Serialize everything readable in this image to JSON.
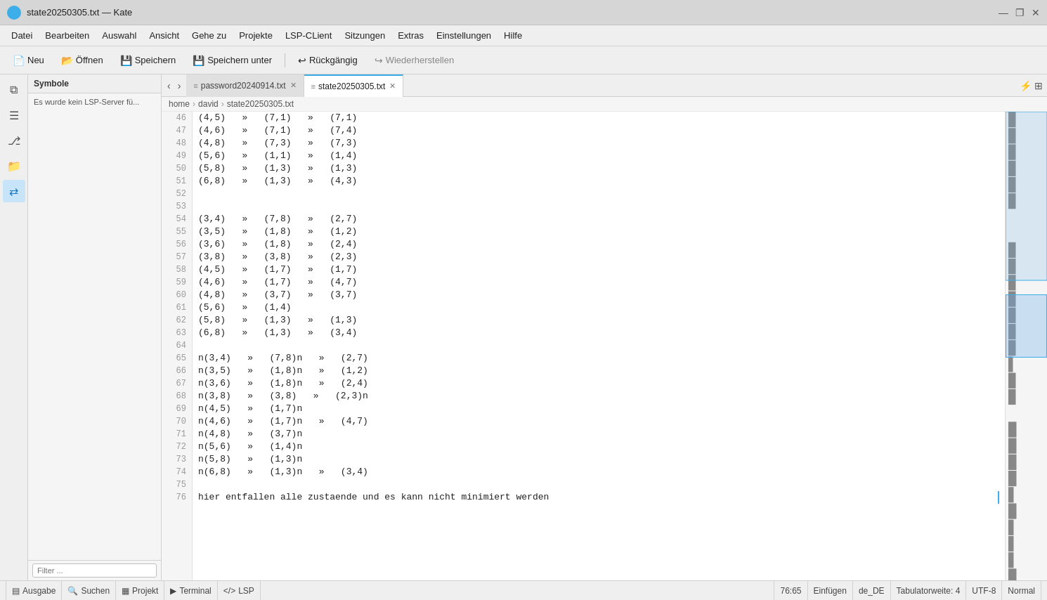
{
  "titleBar": {
    "title": "state20250305.txt — Kate",
    "icon": "kate-icon",
    "buttons": {
      "minimize": "—",
      "restore": "❐",
      "close": "✕"
    }
  },
  "menuBar": {
    "items": [
      "Datei",
      "Bearbeiten",
      "Auswahl",
      "Ansicht",
      "Gehe zu",
      "Projekte",
      "LSP-CLient",
      "Sitzungen",
      "Extras",
      "Einstellungen",
      "Hilfe"
    ]
  },
  "toolbar": {
    "new_label": "Neu",
    "open_label": "Öffnen",
    "save_label": "Speichern",
    "save_as_label": "Speichern unter",
    "undo_label": "Rückgängig",
    "redo_label": "Wiederherstellen"
  },
  "sidePanel": {
    "header": "Symbole",
    "info": "Es wurde kein LSP-Server fü...",
    "filter_placeholder": "Filter ..."
  },
  "tabs": [
    {
      "id": "tab1",
      "label": "password20240914.txt",
      "active": false
    },
    {
      "id": "tab2",
      "label": "state20250305.txt",
      "active": true
    }
  ],
  "breadcrumb": {
    "parts": [
      "home",
      "david",
      "state20250305.txt"
    ]
  },
  "codeLines": [
    {
      "num": 46,
      "content": "(4,5)\t»\t(7,1)\t»\t(7,1)"
    },
    {
      "num": 47,
      "content": "(4,6)\t»\t(7,1)\t»\t(7,4)"
    },
    {
      "num": 48,
      "content": "(4,8)\t»\t(7,3)\t»\t(7,3)"
    },
    {
      "num": 49,
      "content": "(5,6)\t»\t(1,1)\t»\t(1,4)"
    },
    {
      "num": 50,
      "content": "(5,8)\t»\t(1,3)\t»\t(1,3)"
    },
    {
      "num": 51,
      "content": "(6,8)\t»\t(1,3)\t»\t(4,3)"
    },
    {
      "num": 52,
      "content": ""
    },
    {
      "num": 53,
      "content": ""
    },
    {
      "num": 54,
      "content": "(3,4)\t»\t(7,8)\t»\t(2,7)"
    },
    {
      "num": 55,
      "content": "(3,5)\t»\t(1,8)\t»\t(1,2)"
    },
    {
      "num": 56,
      "content": "(3,6)\t»\t(1,8)\t»\t(2,4)"
    },
    {
      "num": 57,
      "content": "(3,8)\t»\t(3,8)\t»\t(2,3)"
    },
    {
      "num": 58,
      "content": "(4,5)\t»\t(1,7)\t»\t(1,7)"
    },
    {
      "num": 59,
      "content": "(4,6)\t»\t(1,7)\t»\t(4,7)"
    },
    {
      "num": 60,
      "content": "(4,8)\t»\t(3,7)\t»\t(3,7)"
    },
    {
      "num": 61,
      "content": "(5,6)\t»\t(1,4)"
    },
    {
      "num": 62,
      "content": "(5,8)\t»\t(1,3)\t»\t(1,3)"
    },
    {
      "num": 63,
      "content": "(6,8)\t»\t(1,3)\t»\t(3,4)"
    },
    {
      "num": 64,
      "content": ""
    },
    {
      "num": 65,
      "content": "n(3,4)\t»\t(7,8)n\t»\t(2,7)"
    },
    {
      "num": 66,
      "content": "n(3,5)\t»\t(1,8)n\t»\t(1,2)"
    },
    {
      "num": 67,
      "content": "n(3,6)\t»\t(1,8)n\t»\t(2,4)"
    },
    {
      "num": 68,
      "content": "n(3,8)\t»\t(3,8)\t»\t(2,3)n"
    },
    {
      "num": 69,
      "content": "n(4,5)\t»\t(1,7)n"
    },
    {
      "num": 70,
      "content": "n(4,6)\t»\t(1,7)n\t»\t(4,7)"
    },
    {
      "num": 71,
      "content": "n(4,8)\t»\t(3,7)n"
    },
    {
      "num": 72,
      "content": "n(5,6)\t»\t(1,4)n"
    },
    {
      "num": 73,
      "content": "n(5,8)\t»\t(1,3)n"
    },
    {
      "num": 74,
      "content": "n(6,8)\t»\t(1,3)n\t»\t(3,4)"
    },
    {
      "num": 75,
      "content": ""
    },
    {
      "num": 76,
      "content": "hier entfallen alle zustaende und es kann nicht minimiert werden"
    }
  ],
  "statusBar": {
    "items": [
      {
        "icon": "terminal-icon",
        "label": "Ausgabe"
      },
      {
        "icon": "search-icon",
        "label": "Suchen"
      },
      {
        "icon": "project-icon",
        "label": "Projekt"
      },
      {
        "icon": "terminal-icon",
        "label": "Terminal"
      },
      {
        "icon": "code-icon",
        "label": "LSP"
      }
    ],
    "right": {
      "position": "76:65",
      "insert_mode": "Einfügen",
      "locale": "de_DE",
      "tab_width": "Tabulatorweite: 4",
      "encoding": "UTF-8",
      "mode": "Normal"
    }
  },
  "sidebarIcons": [
    {
      "id": "documents-icon",
      "symbol": "⧉",
      "active": false
    },
    {
      "id": "list-icon",
      "symbol": "☰",
      "active": false
    },
    {
      "id": "git-icon",
      "symbol": "⎇",
      "active": false
    },
    {
      "id": "folder-icon",
      "symbol": "📁",
      "active": false
    },
    {
      "id": "plugin-icon",
      "symbol": "⇄",
      "active": true
    }
  ]
}
